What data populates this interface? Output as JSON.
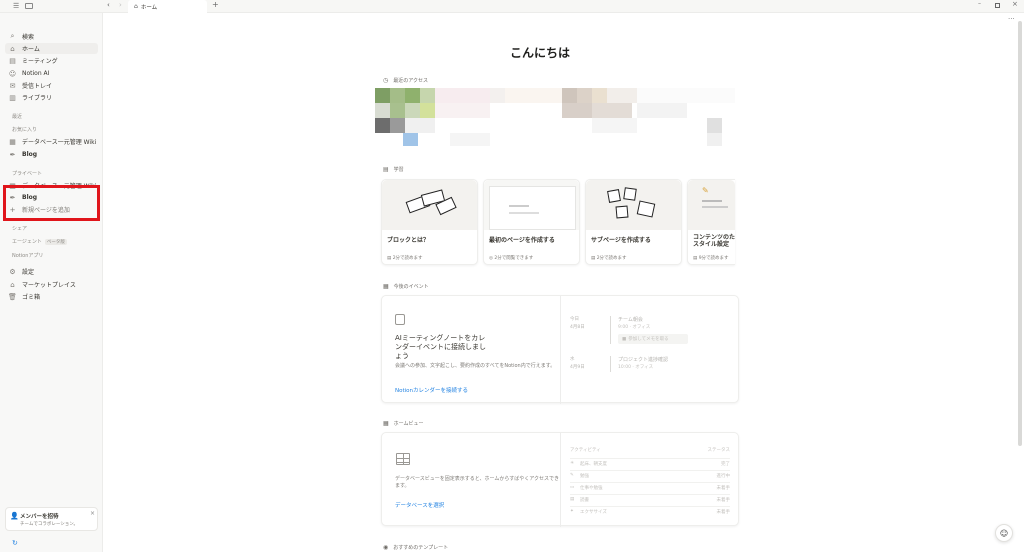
{
  "tabs": {
    "home": "ホーム"
  },
  "sidebar": {
    "nav": [
      {
        "label": "検索",
        "icon": "search-icon"
      },
      {
        "label": "ホーム",
        "icon": "home-icon"
      },
      {
        "label": "ミーティング",
        "icon": "meeting-icon"
      },
      {
        "label": "Notion AI",
        "icon": "ai-icon"
      },
      {
        "label": "受信トレイ",
        "icon": "inbox-icon"
      },
      {
        "label": "ライブラリ",
        "icon": "library-icon"
      }
    ],
    "recent_label": "最近",
    "favorites_label": "お気に入り",
    "favorites": [
      {
        "label": "データベース一元管理 Wiki",
        "icon": "database-icon"
      },
      {
        "label": "Blog",
        "icon": "blog-icon"
      }
    ],
    "private_label": "プライベート",
    "private": [
      {
        "label": "データベース一元管理 Wiki",
        "icon": "database-icon"
      },
      {
        "label": "Blog",
        "icon": "blog-icon"
      },
      {
        "label": "新規ページを追加",
        "icon": "plus-icon"
      }
    ],
    "shared_label": "シェア",
    "agent_label": "エージェント",
    "agent_badge": "ベータ版",
    "apps_label": "Notionアプリ",
    "bottom": [
      {
        "label": "設定",
        "icon": "gear-icon"
      },
      {
        "label": "マーケットプレイス",
        "icon": "marketplace-icon"
      },
      {
        "label": "ゴミ箱",
        "icon": "trash-icon"
      }
    ],
    "invite_title": "メンバーを招待",
    "invite_sub": "チームでコラボレーション。"
  },
  "main": {
    "greeting": "こんにちは",
    "recent_title": "最近のアクセス",
    "learn_title": "学習",
    "learn_cards": [
      {
        "title": "ブロックとは？",
        "meta": "2分で読めます"
      },
      {
        "title": "最初のページを作成する",
        "meta": "2分で閲覧できます"
      },
      {
        "title": "サブページを作成する",
        "meta": "2分で読めます"
      },
      {
        "title": "コンテンツのたっ\nスタイル設定",
        "meta": "9分で読めます"
      }
    ],
    "events_title": "今後のイベント",
    "events_heading": "AIミーティングノートをカレンダーイベントに接続しましょう",
    "events_desc": "会議への参加、文字起こし、要約作成のすべてをNotion内で行えます。",
    "events_link": "Notionカレンダーを接続する",
    "events_list": [
      {
        "day": "今日",
        "date": "4月8日",
        "title": "チーム朝会",
        "time": "9:00 · オフィス",
        "btn": "参加してメモを取る"
      },
      {
        "day": "水",
        "date": "4月9日",
        "title": "プロジェクト進捗確認",
        "time": "10:00 · オフィス"
      }
    ],
    "homeview_title": "ホームビュー",
    "homeview_desc": "データベースビューを固定表示すると、ホームからすばやくアクセスできます。",
    "homeview_link": "データベースを選択",
    "activity_header": {
      "left": "アクティビティ",
      "right": "ステータス"
    },
    "activities": [
      {
        "label": "起床、朝支度",
        "status": "完了"
      },
      {
        "label": "勉強",
        "status": "進行中"
      },
      {
        "label": "仕事や勉強",
        "status": "未着手"
      },
      {
        "label": "読書",
        "status": "未着手"
      },
      {
        "label": "エクササイズ",
        "status": "未着手"
      }
    ],
    "templates_title": "おすすめのテンプレート"
  },
  "colors": {
    "highlight": "#e0151b",
    "link": "#2383e2"
  }
}
